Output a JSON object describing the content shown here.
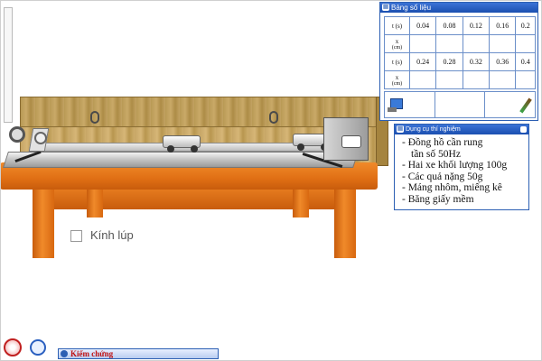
{
  "data_window": {
    "title": "Bảng số liệu",
    "row1": {
      "t_label": "t",
      "t_unit": "(s)",
      "x_label": "x",
      "x_unit": "(cm)",
      "t_values": [
        "0.04",
        "0.08",
        "0.12",
        "0.16",
        "0.2"
      ]
    },
    "row2": {
      "t_label": "t",
      "t_unit": "(s)",
      "x_label": "x",
      "x_unit": "(cm)",
      "t_values": [
        "0.24",
        "0.28",
        "0.32",
        "0.36",
        "0.4"
      ]
    }
  },
  "equipment_window": {
    "title": "Dụng cụ thí nghiệm",
    "items": [
      "- Đồng hồ cần rung",
      "   tần số 50Hz",
      "- Hai xe khối lượng 100g",
      "- Các quả nặng 50g",
      "- Máng nhôm, miếng kê",
      "- Băng giấy mềm"
    ]
  },
  "magnifier": {
    "label": "Kính lúp",
    "checked": false
  },
  "bottom": {
    "verify_label": "Kiểm chứng"
  },
  "colors": {
    "window_border": "#2c5fb3",
    "titlebar": "#1b4fb0",
    "table_wood": "#e06f14"
  }
}
